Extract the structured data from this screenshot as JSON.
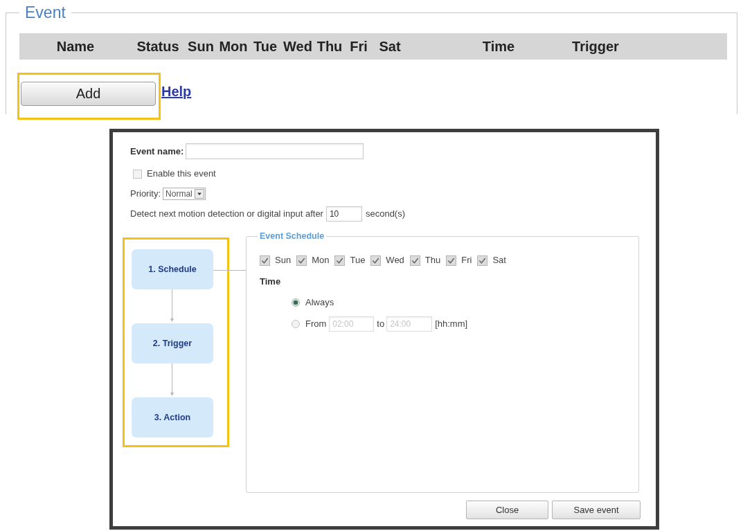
{
  "event_section": {
    "legend": "Event",
    "columns": [
      "Name",
      "Status",
      "Sun",
      "Mon",
      "Tue",
      "Wed",
      "Thu",
      "Fri",
      "Sat",
      "Time",
      "Trigger"
    ],
    "add_button": {
      "label": "Add",
      "highlighted": true
    },
    "help_link": "Help"
  },
  "dialog": {
    "event_name": {
      "label": "Event name:"
    },
    "enable": {
      "label": "Enable this event",
      "checked": false
    },
    "priority": {
      "label": "Priority:",
      "value": "Normal"
    },
    "detect": {
      "text": "Detect next motion detection or digital input after",
      "value": "10",
      "unit": "second(s)"
    },
    "steps_highlighted": true,
    "steps": [
      {
        "label": "1. Schedule"
      },
      {
        "label": "2. Trigger"
      },
      {
        "label": "3. Action"
      }
    ],
    "schedule": {
      "legend": "Event Schedule",
      "days": [
        {
          "label": "Sun",
          "checked": true
        },
        {
          "label": "Mon",
          "checked": true
        },
        {
          "label": "Tue",
          "checked": true
        },
        {
          "label": "Wed",
          "checked": true
        },
        {
          "label": "Thu",
          "checked": true
        },
        {
          "label": "Fri",
          "checked": true
        },
        {
          "label": "Sat",
          "checked": true
        }
      ],
      "time_label": "Time",
      "time_options": [
        {
          "kind": "always",
          "label": "Always",
          "selected": true
        },
        {
          "kind": "range",
          "label": "From",
          "selected": false,
          "from": "02:00",
          "to_label": "to",
          "to": "24:00",
          "disabled": true,
          "format": "[hh:mm]"
        }
      ]
    },
    "buttons": [
      "Close",
      "Save event"
    ]
  }
}
